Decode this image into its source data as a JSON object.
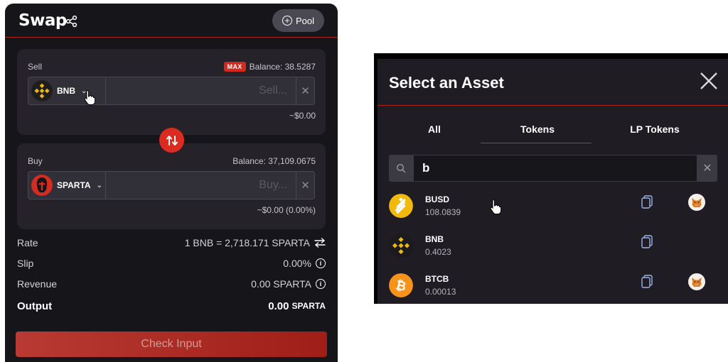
{
  "swap": {
    "title": "Swap",
    "pool_label": "Pool",
    "sell": {
      "label": "Sell",
      "max_label": "MAX",
      "balance": "Balance: 38.5287",
      "token": "BNB",
      "placeholder": "Sell...",
      "usd": "~$0.00"
    },
    "buy": {
      "label": "Buy",
      "balance": "Balance: 37,109.0675",
      "token": "SPARTA",
      "placeholder": "Buy...",
      "usd": "~$0.00 (0.00%)"
    },
    "rate": {
      "label": "Rate",
      "value": "1 BNB = 2,718.171 SPARTA"
    },
    "slip": {
      "label": "Slip",
      "value": "0.00%"
    },
    "revenue": {
      "label": "Revenue",
      "value": "0.00 SPARTA"
    },
    "output": {
      "label": "Output",
      "value": "0.00",
      "unit": "SPARTA"
    },
    "check_button": "Check Input"
  },
  "asset_modal": {
    "title": "Select an Asset",
    "tabs": [
      "All",
      "Tokens",
      "LP Tokens"
    ],
    "active_tab": "Tokens",
    "search_value": "b",
    "assets": [
      {
        "symbol": "BUSD",
        "balance": "108.0839",
        "icon": "busd-logo",
        "wallet": "metamask-fox-icon"
      },
      {
        "symbol": "BNB",
        "balance": "0.4023",
        "icon": "bnb-logo",
        "wallet": ""
      },
      {
        "symbol": "BTCB",
        "balance": "0.00013",
        "icon": "btcb-logo",
        "wallet": "metamask-fox-icon"
      }
    ]
  },
  "colors": {
    "accent_red": "#dc2b21",
    "panel_bg": "#161519",
    "box_bg": "#252329",
    "bnb_yellow": "#f0b90b",
    "btc_orange": "#f7931a"
  }
}
